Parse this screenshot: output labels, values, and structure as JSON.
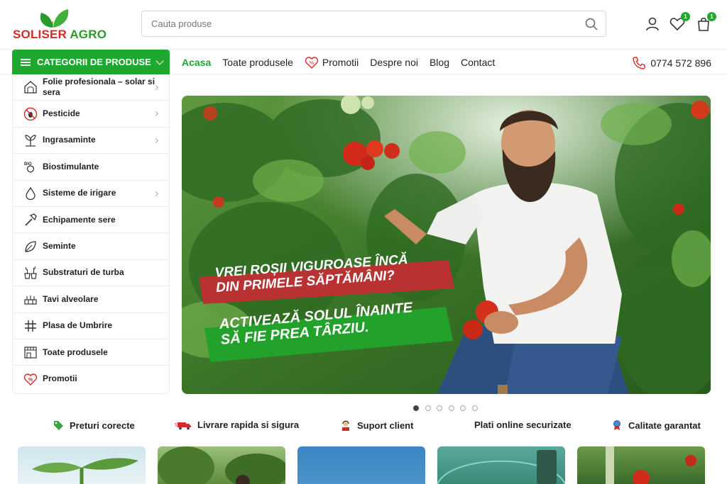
{
  "header": {
    "brand_part1": "SOLISER",
    "brand_part2": "AGRO",
    "search_placeholder": "Cauta produse",
    "wishlist_count": "1",
    "cart_count": "1"
  },
  "nav": {
    "categories_label": "CATEGORII DE PRODUSE",
    "items": [
      {
        "label": "Acasa"
      },
      {
        "label": "Toate produsele"
      },
      {
        "label": "Promotii"
      },
      {
        "label": "Despre noi"
      },
      {
        "label": "Blog"
      },
      {
        "label": "Contact"
      }
    ],
    "phone": "0774 572 896"
  },
  "sidebar": {
    "items": [
      {
        "label": "Folie profesionala – solar si sera",
        "icon": "greenhouse-icon",
        "has_sub": true
      },
      {
        "label": "Pesticide",
        "icon": "bug-icon",
        "has_sub": true
      },
      {
        "label": "Ingrasaminte",
        "icon": "sprout-icon",
        "has_sub": true
      },
      {
        "label": "Biostimulante",
        "icon": "bio-icon",
        "has_sub": false
      },
      {
        "label": "Sisteme de irigare",
        "icon": "droplet-icon",
        "has_sub": true
      },
      {
        "label": "Echipamente sere",
        "icon": "hammer-icon",
        "has_sub": false
      },
      {
        "label": "Seminte",
        "icon": "leaf-icon",
        "has_sub": false
      },
      {
        "label": "Substraturi de turba",
        "icon": "pots-icon",
        "has_sub": false
      },
      {
        "label": "Tavi alveolare",
        "icon": "tray-icon",
        "has_sub": false
      },
      {
        "label": "Plasa de Umbrire",
        "icon": "grid-icon",
        "has_sub": false
      },
      {
        "label": "Toate produsele",
        "icon": "store-icon",
        "has_sub": false
      },
      {
        "label": "Promotii",
        "icon": "heart-percent-icon",
        "has_sub": false
      }
    ]
  },
  "hero": {
    "line1": "VREI ROȘII VIGUROASE ÎNCĂ",
    "line2": "DIN PRIMELE SĂPTĂMÂNI?",
    "line3": "ACTIVEAZĂ SOLUL ÎNAINTE",
    "line4": "SĂ FIE PREA TÂRZIU.",
    "slides": 6,
    "active_slide": 1
  },
  "features": [
    {
      "label": "Preturi corecte"
    },
    {
      "label": "Livrare rapida si sigura"
    },
    {
      "label": "Suport client"
    },
    {
      "label": "Plati online securizate"
    },
    {
      "label": "Calitate garantat"
    }
  ],
  "colors": {
    "brand_green": "#1fa830",
    "brand_red": "#d62a2a",
    "banner_red": "#b83232",
    "banner_green": "#22a22a"
  }
}
